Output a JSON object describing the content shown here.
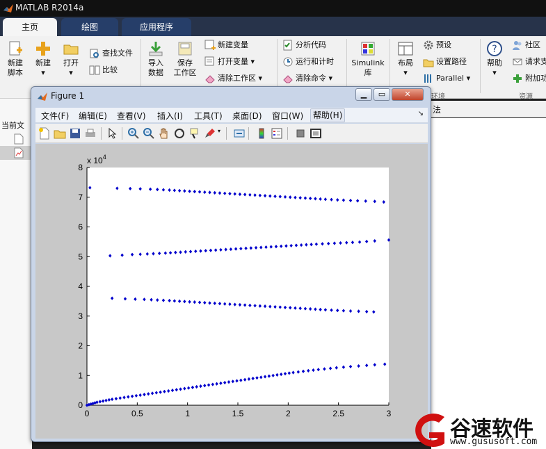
{
  "app": {
    "title": "MATLAB R2014a"
  },
  "tabs": [
    {
      "label": "主页"
    },
    {
      "label": "绘图"
    },
    {
      "label": "应用程序"
    }
  ],
  "ribbon": {
    "new_script": "新建\n脚本",
    "new": "新建",
    "open": "打开",
    "find_files": "查找文件",
    "compare": "比较",
    "import_data": "导入\n数据",
    "save_workspace": "保存\n工作区",
    "new_variable": "新建变量",
    "open_variable": "打开变量",
    "clear_workspace": "清除工作区",
    "analyze_code": "分析代码",
    "run_and_time": "运行和计时",
    "clear_commands": "清除命令",
    "simulink": "Simulink\n库",
    "layout": "布局",
    "preferences": "预设",
    "set_path": "设置路径",
    "parallel": "Parallel",
    "help": "帮助",
    "community": "社区",
    "request_support": "请求支",
    "addons": "附加功",
    "group_env": "环境",
    "group_resources": "资源"
  },
  "address": {
    "text": "法",
    "current_folder": "当前文"
  },
  "figure": {
    "title": "Figure 1",
    "menus": [
      "文件(F)",
      "编辑(E)",
      "查看(V)",
      "插入(I)",
      "工具(T)",
      "桌面(D)",
      "窗口(W)",
      "帮助(H)"
    ],
    "window_buttons": {
      "minimize": "▁",
      "maximize": "▭",
      "close": "✕"
    }
  },
  "chart_data": {
    "type": "scatter",
    "title": "",
    "xlabel": "",
    "ylabel": "",
    "y_exponent_label": "x 10^4",
    "xlim": [
      0,
      3
    ],
    "ylim": [
      0,
      8
    ],
    "xticks": [
      "0",
      "0.5",
      "1",
      "1.5",
      "2",
      "2.5",
      "3"
    ],
    "yticks": [
      "0",
      "1",
      "2",
      "3",
      "4",
      "5",
      "6",
      "7",
      "8"
    ],
    "marker_color": "#0000cc",
    "series": [
      {
        "x": [
          0.03,
          0.3,
          0.43,
          0.53,
          0.63,
          0.7,
          0.76,
          0.82,
          0.87,
          0.92,
          0.97,
          1.02,
          1.07,
          1.12,
          1.17,
          1.22,
          1.27,
          1.32,
          1.37,
          1.42,
          1.47,
          1.52,
          1.57,
          1.62,
          1.67,
          1.72,
          1.77,
          1.82,
          1.87,
          1.92,
          1.97,
          2.02,
          2.07,
          2.12,
          2.17,
          2.22,
          2.27,
          2.32,
          2.37,
          2.43,
          2.49,
          2.55,
          2.62,
          2.69,
          2.77,
          2.86,
          2.95
        ],
        "y": [
          7.32,
          7.3,
          7.29,
          7.28,
          7.27,
          7.26,
          7.25,
          7.24,
          7.23,
          7.22,
          7.21,
          7.2,
          7.19,
          7.18,
          7.17,
          7.16,
          7.15,
          7.14,
          7.13,
          7.12,
          7.11,
          7.1,
          7.09,
          7.08,
          7.07,
          7.06,
          7.05,
          7.04,
          7.03,
          7.02,
          7.01,
          7.0,
          6.99,
          6.98,
          6.97,
          6.96,
          6.95,
          6.94,
          6.93,
          6.92,
          6.91,
          6.9,
          6.89,
          6.88,
          6.87,
          6.86,
          6.84
        ]
      },
      {
        "x": [
          0.23,
          0.35,
          0.45,
          0.53,
          0.6,
          0.66,
          0.72,
          0.78,
          0.83,
          0.88,
          0.93,
          0.98,
          1.03,
          1.08,
          1.13,
          1.18,
          1.23,
          1.28,
          1.33,
          1.38,
          1.43,
          1.48,
          1.53,
          1.58,
          1.63,
          1.68,
          1.73,
          1.78,
          1.83,
          1.88,
          1.93,
          1.98,
          2.03,
          2.08,
          2.13,
          2.18,
          2.23,
          2.28,
          2.34,
          2.4,
          2.46,
          2.52,
          2.58,
          2.64,
          2.71,
          2.78,
          2.86,
          3.0
        ],
        "y": [
          5.03,
          5.05,
          5.07,
          5.08,
          5.09,
          5.1,
          5.11,
          5.12,
          5.13,
          5.14,
          5.15,
          5.16,
          5.17,
          5.18,
          5.19,
          5.2,
          5.21,
          5.22,
          5.23,
          5.24,
          5.25,
          5.26,
          5.27,
          5.28,
          5.29,
          5.3,
          5.31,
          5.32,
          5.33,
          5.34,
          5.35,
          5.36,
          5.37,
          5.38,
          5.39,
          5.4,
          5.41,
          5.42,
          5.43,
          5.44,
          5.45,
          5.46,
          5.47,
          5.48,
          5.49,
          5.51,
          5.53,
          5.56
        ]
      },
      {
        "x": [
          0.25,
          0.38,
          0.48,
          0.57,
          0.64,
          0.7,
          0.76,
          0.82,
          0.87,
          0.92,
          0.97,
          1.02,
          1.07,
          1.12,
          1.17,
          1.22,
          1.27,
          1.32,
          1.37,
          1.42,
          1.47,
          1.52,
          1.57,
          1.62,
          1.67,
          1.72,
          1.77,
          1.82,
          1.87,
          1.92,
          1.97,
          2.02,
          2.07,
          2.12,
          2.17,
          2.22,
          2.27,
          2.32,
          2.37,
          2.43,
          2.49,
          2.55,
          2.62,
          2.7,
          2.78,
          2.85
        ],
        "y": [
          3.6,
          3.58,
          3.57,
          3.56,
          3.55,
          3.54,
          3.53,
          3.52,
          3.51,
          3.5,
          3.49,
          3.48,
          3.47,
          3.46,
          3.45,
          3.44,
          3.43,
          3.42,
          3.41,
          3.4,
          3.39,
          3.38,
          3.37,
          3.36,
          3.35,
          3.34,
          3.33,
          3.32,
          3.31,
          3.3,
          3.29,
          3.28,
          3.27,
          3.26,
          3.25,
          3.24,
          3.23,
          3.22,
          3.21,
          3.2,
          3.19,
          3.18,
          3.17,
          3.16,
          3.15,
          3.14
        ]
      },
      {
        "x": [
          0.0,
          0.02,
          0.04,
          0.06,
          0.08,
          0.1,
          0.13,
          0.16,
          0.19,
          0.22,
          0.25,
          0.29,
          0.33,
          0.37,
          0.41,
          0.45,
          0.49,
          0.53,
          0.57,
          0.61,
          0.65,
          0.69,
          0.73,
          0.77,
          0.81,
          0.85,
          0.89,
          0.93,
          0.97,
          1.01,
          1.05,
          1.09,
          1.13,
          1.17,
          1.21,
          1.25,
          1.29,
          1.33,
          1.37,
          1.41,
          1.45,
          1.49,
          1.53,
          1.57,
          1.61,
          1.65,
          1.69,
          1.73,
          1.77,
          1.81,
          1.85,
          1.89,
          1.93,
          1.97,
          2.01,
          2.05,
          2.1,
          2.15,
          2.2,
          2.25,
          2.3,
          2.36,
          2.42,
          2.48,
          2.55,
          2.62,
          2.7,
          2.78,
          2.86,
          2.96
        ],
        "y": [
          0.0,
          0.02,
          0.04,
          0.06,
          0.08,
          0.1,
          0.12,
          0.14,
          0.16,
          0.18,
          0.2,
          0.22,
          0.24,
          0.26,
          0.28,
          0.3,
          0.32,
          0.34,
          0.36,
          0.38,
          0.4,
          0.42,
          0.44,
          0.46,
          0.48,
          0.5,
          0.52,
          0.54,
          0.56,
          0.58,
          0.6,
          0.62,
          0.64,
          0.66,
          0.68,
          0.7,
          0.72,
          0.74,
          0.76,
          0.78,
          0.8,
          0.82,
          0.84,
          0.86,
          0.88,
          0.9,
          0.92,
          0.94,
          0.96,
          0.98,
          1.0,
          1.02,
          1.04,
          1.06,
          1.08,
          1.1,
          1.12,
          1.14,
          1.16,
          1.18,
          1.2,
          1.22,
          1.24,
          1.26,
          1.28,
          1.3,
          1.32,
          1.34,
          1.36,
          1.38
        ]
      }
    ]
  },
  "watermark": {
    "brand": "谷速软件",
    "url": "www.gususoft.com",
    "accent": "#d01010"
  }
}
